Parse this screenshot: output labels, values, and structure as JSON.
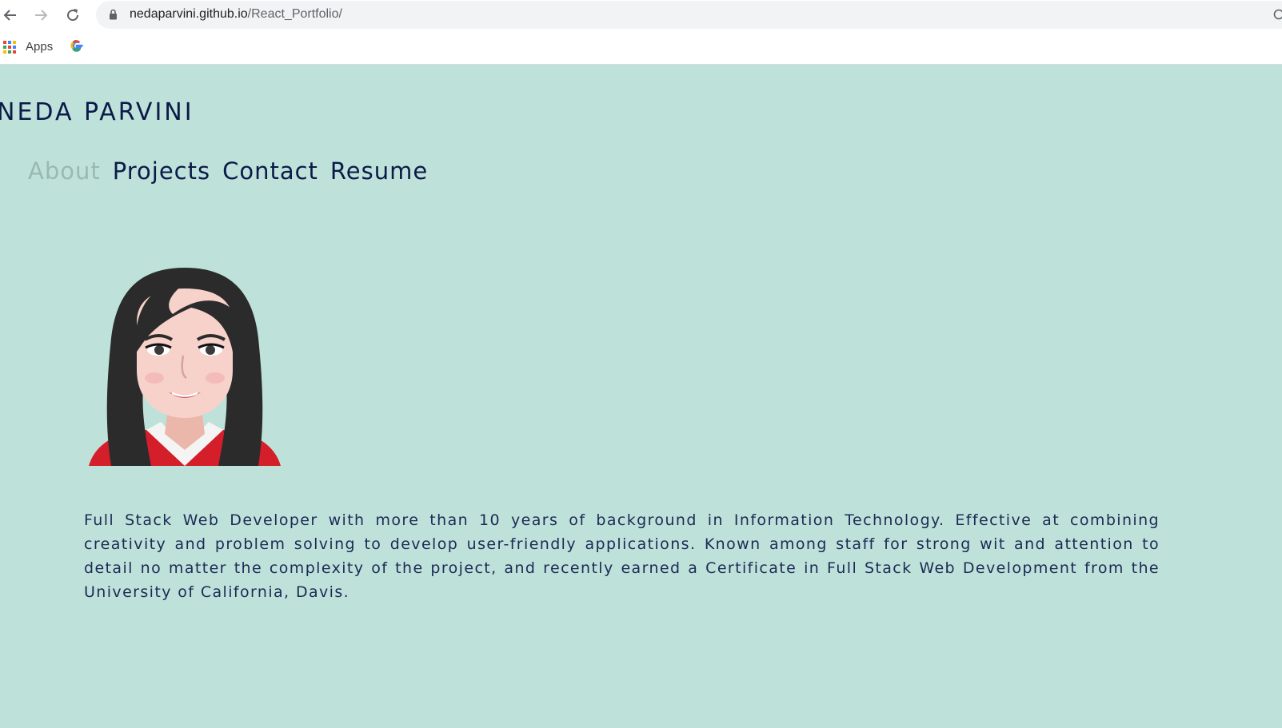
{
  "browser": {
    "url_host": "nedaparvini.github.io",
    "url_path": "/React_Portfolio/",
    "bookmarks": {
      "apps_label": "Apps"
    }
  },
  "site": {
    "brand": "NEDA PARVINI",
    "nav": [
      "About",
      "Projects",
      "Contact",
      "Resume"
    ],
    "active_nav": "About",
    "bio": "Full Stack Web Developer with more than 10 years of background in Information Technology. Effective at combining creativity and problem solving to develop user-friendly applications. Known among staff for strong wit and attention to detail no matter the complexity of the project, and recently earned a Certificate in Full Stack Web Development from the University of California, Davis."
  },
  "colors": {
    "page_background": "#bee2da",
    "text_dark": "#0b1a48",
    "nav_active": "#9bb8b2"
  }
}
